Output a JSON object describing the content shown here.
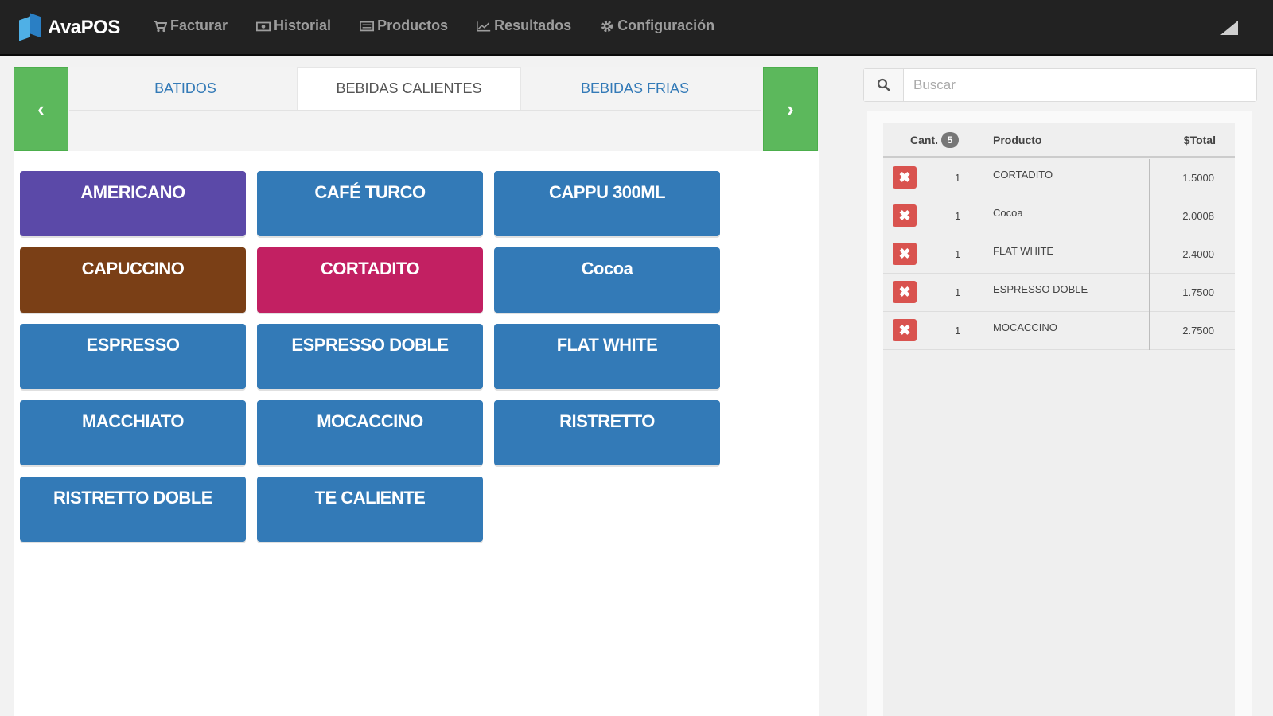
{
  "app": {
    "brand": "AvaPOS"
  },
  "nav": [
    {
      "label": "Facturar",
      "icon": "cart-icon"
    },
    {
      "label": "Historial",
      "icon": "money-icon"
    },
    {
      "label": "Productos",
      "icon": "list-icon"
    },
    {
      "label": "Resultados",
      "icon": "line-chart-icon"
    },
    {
      "label": "Configuración",
      "icon": "gear-icon"
    }
  ],
  "categories": {
    "prev": "‹",
    "next": "›",
    "tabs": [
      "BATIDOS",
      "BEBIDAS CALIENTES",
      "BEBIDAS FRIAS"
    ],
    "active": "BEBIDAS CALIENTES"
  },
  "products": [
    {
      "label": "AMERICANO",
      "color": "#5b49a8"
    },
    {
      "label": "CAFÉ TURCO",
      "color": "#337ab7"
    },
    {
      "label": "CAPPU 300ML",
      "color": "#337ab7"
    },
    {
      "label": "CAPUCCINO",
      "color": "#7a3f16"
    },
    {
      "label": "CORTADITO",
      "color": "#c22062"
    },
    {
      "label": "Cocoa",
      "color": "#337ab7"
    },
    {
      "label": "ESPRESSO",
      "color": "#337ab7"
    },
    {
      "label": "ESPRESSO DOBLE",
      "color": "#337ab7"
    },
    {
      "label": "FLAT WHITE",
      "color": "#337ab7"
    },
    {
      "label": "MACCHIATO",
      "color": "#337ab7"
    },
    {
      "label": "MOCACCINO",
      "color": "#337ab7"
    },
    {
      "label": "RISTRETTO",
      "color": "#337ab7"
    },
    {
      "label": "RISTRETTO DOBLE",
      "color": "#337ab7"
    },
    {
      "label": "TE CALIENTE",
      "color": "#337ab7"
    }
  ],
  "search": {
    "placeholder": "Buscar"
  },
  "cart": {
    "headers": {
      "qty": "Cant.",
      "count": "5",
      "product": "Producto",
      "total": "$Total"
    },
    "delete_glyph": "✖",
    "rows": [
      {
        "qty": "1",
        "product": "CORTADITO",
        "total": "1.5000"
      },
      {
        "qty": "1",
        "product": "Cocoa",
        "total": "2.0008"
      },
      {
        "qty": "1",
        "product": "FLAT WHITE",
        "total": "2.4000"
      },
      {
        "qty": "1",
        "product": "ESPRESSO DOBLE",
        "total": "1.7500"
      },
      {
        "qty": "1",
        "product": "MOCACCINO",
        "total": "2.7500"
      }
    ]
  }
}
